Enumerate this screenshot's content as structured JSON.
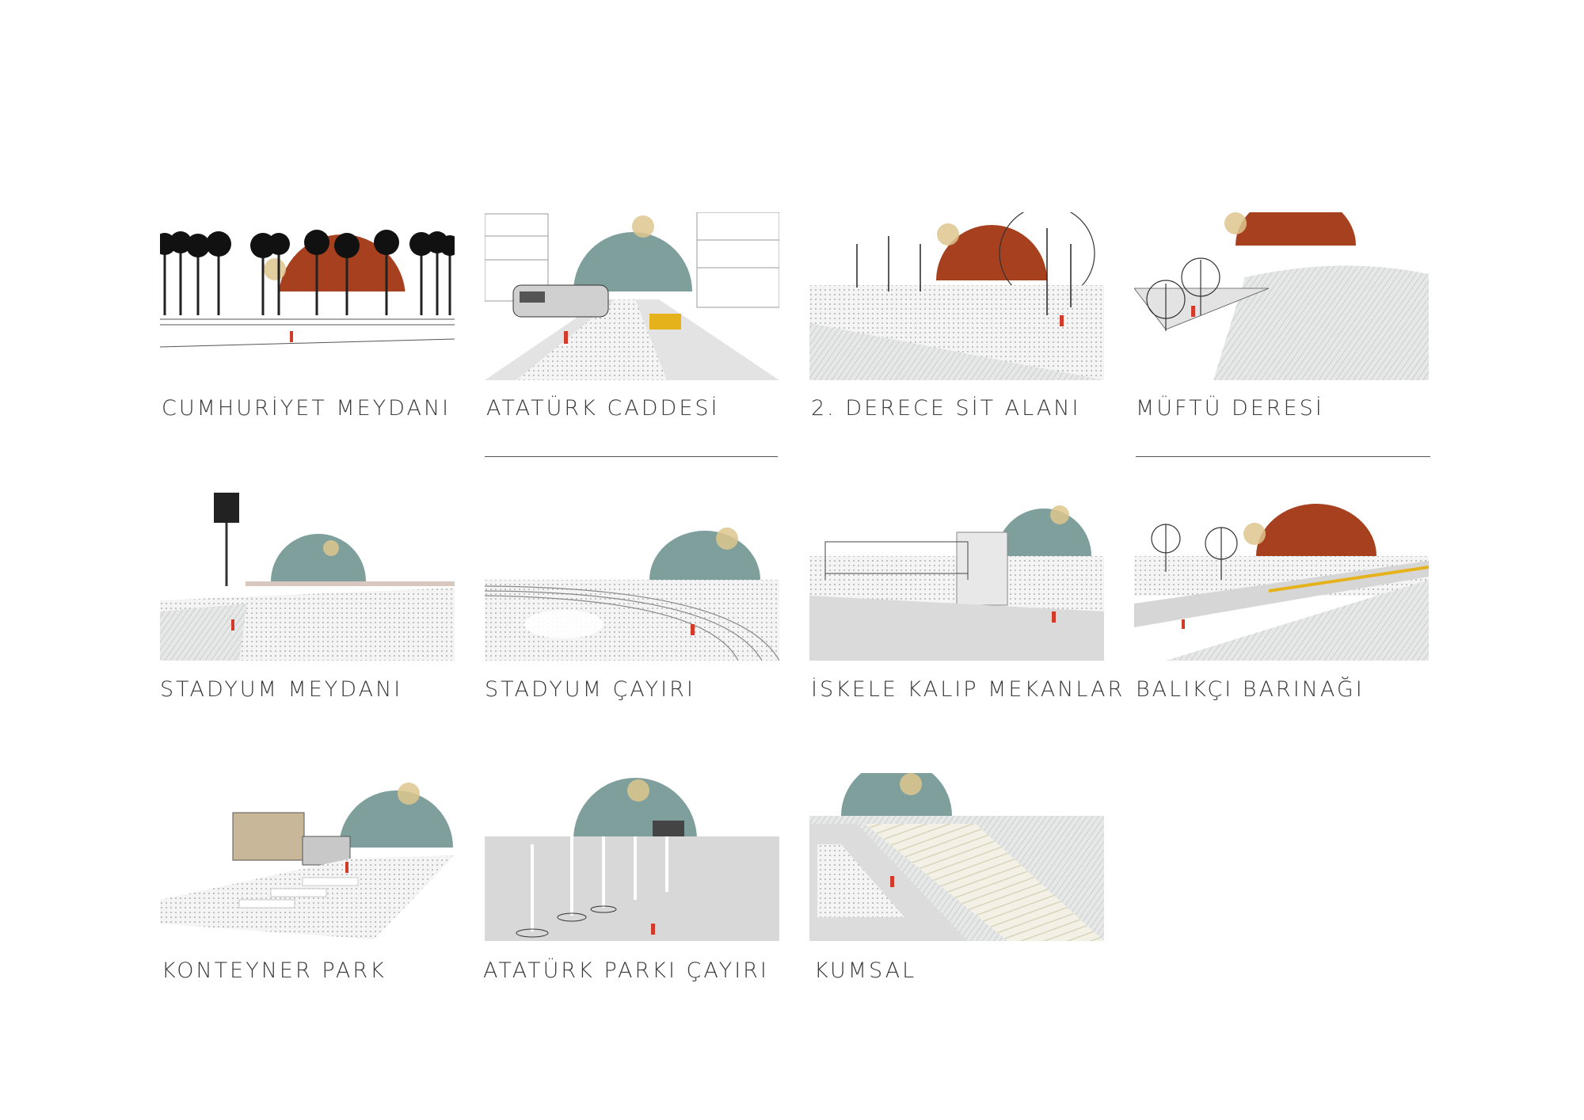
{
  "colors": {
    "rust": "#a7401f",
    "teal": "#7e9f9c",
    "sun": "#ddc58e",
    "ground": "#e3e3e3",
    "ground_dark": "#cfcfcf",
    "accent_red": "#d23a2a",
    "accent_yellow": "#e6b21c",
    "line": "#444444"
  },
  "panels": [
    {
      "id": "cumhuriyet",
      "title": "CUMHURİYET MEYDANI",
      "dome": "rust",
      "scene": "palms"
    },
    {
      "id": "ataturk-cad",
      "title": "ATATÜRK CADDESİ",
      "dome": "teal",
      "scene": "tram"
    },
    {
      "id": "sit-alani",
      "title": "2. DERECE SİT ALANI",
      "dome": "rust",
      "scene": "trees"
    },
    {
      "id": "muftu",
      "title": "MÜFTÜ DERESİ",
      "dome": "rust",
      "scene": "bridge"
    },
    {
      "id": "stadyum-meydani",
      "title": "STADYUM MEYDANI",
      "dome": "teal",
      "scene": "stadium"
    },
    {
      "id": "stadyum-cayiri",
      "title": "STADYUM ÇAYIRI",
      "dome": "teal",
      "scene": "track"
    },
    {
      "id": "iskele",
      "title": "İSKELE KALIP MEKANLAR",
      "dome": "teal",
      "scene": "pavilion"
    },
    {
      "id": "balikci",
      "title": "BALIKÇI BARINAĞI",
      "dome": "rust",
      "scene": "harbor"
    },
    {
      "id": "konteyner",
      "title": "KONTEYNER PARK",
      "dome": "teal",
      "scene": "container"
    },
    {
      "id": "ataturk-parki",
      "title": "ATATÜRK PARKI ÇAYIRI",
      "dome": "teal",
      "scene": "park"
    },
    {
      "id": "kumsal",
      "title": "KUMSAL",
      "dome": "teal",
      "scene": "beach"
    }
  ]
}
